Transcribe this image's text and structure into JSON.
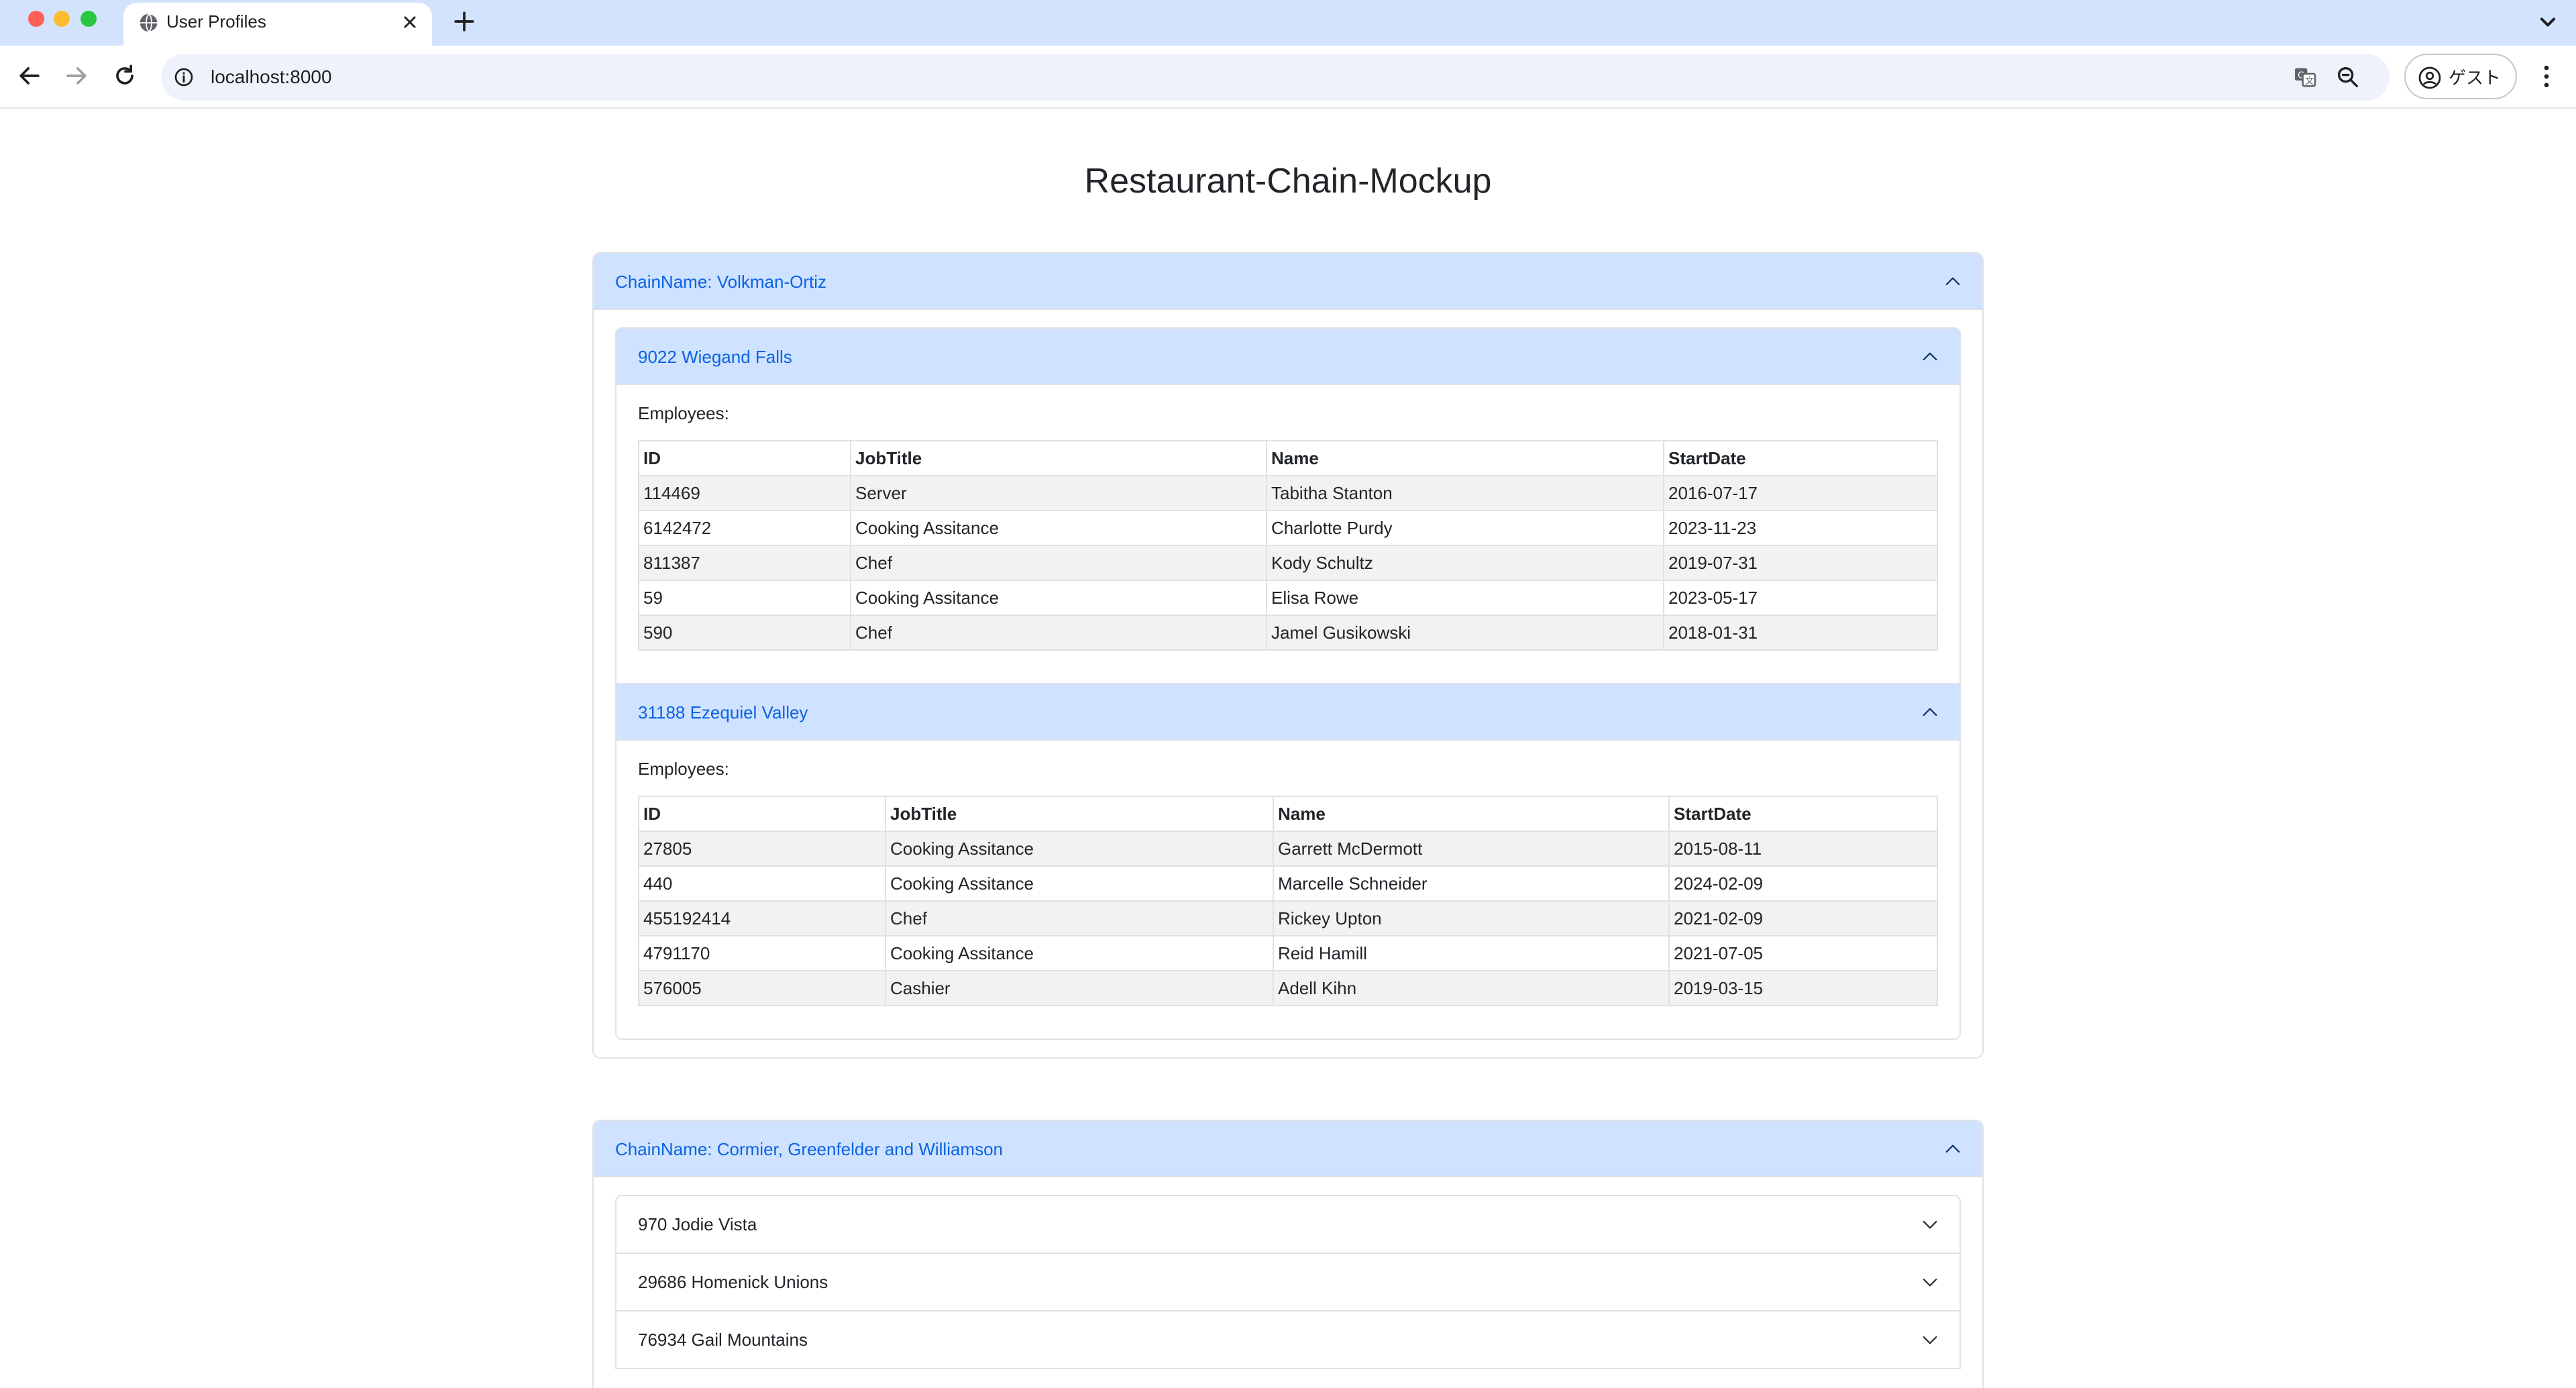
{
  "browser": {
    "tab_title": "User Profiles",
    "url": "localhost:8000",
    "profile_label": "ゲスト"
  },
  "page": {
    "title": "Restaurant-Chain-Mockup"
  },
  "chains": [
    {
      "label": "ChainName: Volkman-Ortiz",
      "locations": [
        {
          "label": "9022 Wiegand Falls",
          "employees_label": "Employees:",
          "columns": [
            "ID",
            "JobTitle",
            "Name",
            "StartDate"
          ],
          "rows": [
            [
              "114469",
              "Server",
              "Tabitha Stanton",
              "2016-07-17"
            ],
            [
              "6142472",
              "Cooking Assitance",
              "Charlotte Purdy",
              "2023-11-23"
            ],
            [
              "811387",
              "Chef",
              "Kody Schultz",
              "2019-07-31"
            ],
            [
              "59",
              "Cooking Assitance",
              "Elisa Rowe",
              "2023-05-17"
            ],
            [
              "590",
              "Chef",
              "Jamel Gusikowski",
              "2018-01-31"
            ]
          ]
        },
        {
          "label": "31188 Ezequiel Valley",
          "employees_label": "Employees:",
          "columns": [
            "ID",
            "JobTitle",
            "Name",
            "StartDate"
          ],
          "rows": [
            [
              "27805",
              "Cooking Assitance",
              "Garrett McDermott",
              "2015-08-11"
            ],
            [
              "440",
              "Cooking Assitance",
              "Marcelle Schneider",
              "2024-02-09"
            ],
            [
              "455192414",
              "Chef",
              "Rickey Upton",
              "2021-02-09"
            ],
            [
              "4791170",
              "Cooking Assitance",
              "Reid Hamill",
              "2021-07-05"
            ],
            [
              "576005",
              "Cashier",
              "Adell Kihn",
              "2019-03-15"
            ]
          ]
        }
      ]
    },
    {
      "label": "ChainName: Cormier, Greenfelder and Williamson",
      "locations": [
        {
          "label": "970 Jodie Vista"
        },
        {
          "label": "29686 Homenick Unions"
        },
        {
          "label": "76934 Gail Mountains"
        }
      ]
    }
  ]
}
